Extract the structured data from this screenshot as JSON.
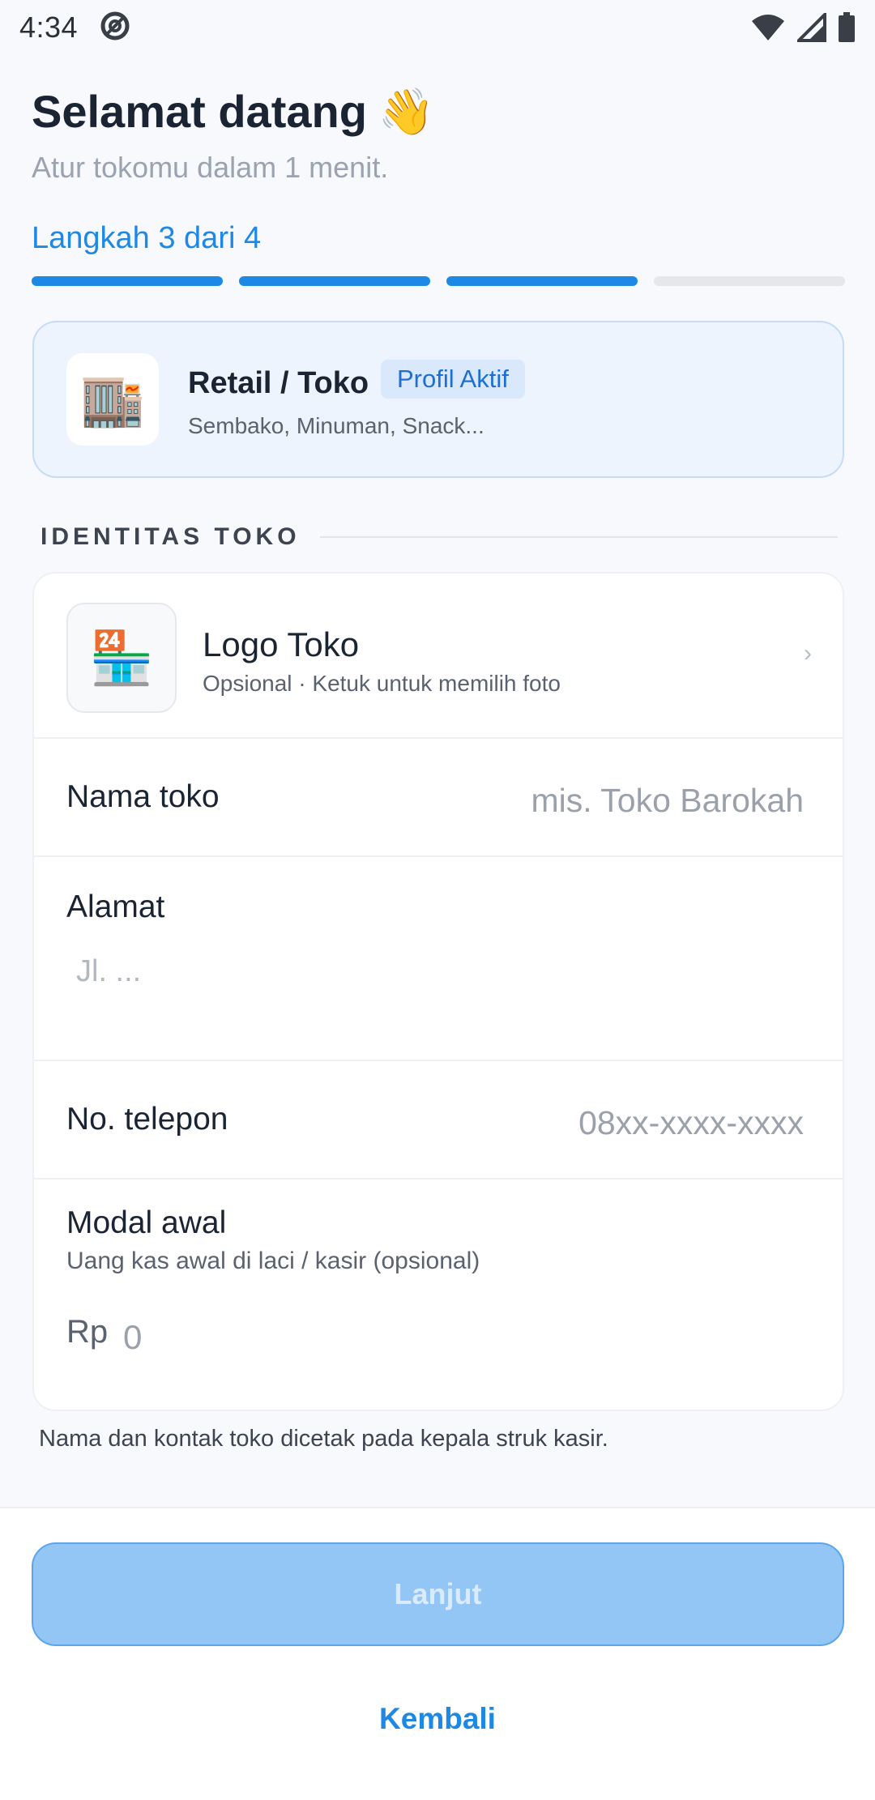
{
  "status_bar": {
    "time": "4:34"
  },
  "header": {
    "title": "Selamat datang",
    "title_emoji": "👋",
    "subtitle": "Atur tokomu dalam 1 menit.",
    "step_label": "Langkah 3 dari 4",
    "progress": {
      "current_step": 3,
      "total_steps": 4
    }
  },
  "profile": {
    "icon": "🏬",
    "name": "Retail / Toko",
    "badge": "Profil Aktif",
    "description": "Sembako, Minuman, Snack..."
  },
  "section": {
    "title": "IDENTITAS TOKO"
  },
  "form": {
    "logo": {
      "icon": "🏪",
      "title": "Logo Toko",
      "subtitle": "Opsional · Ketuk untuk memilih foto",
      "chevron": "›"
    },
    "name": {
      "label": "Nama toko",
      "placeholder": "mis. Toko Barokah",
      "value": ""
    },
    "address": {
      "label": "Alamat",
      "placeholder": "Jl. ...",
      "value": ""
    },
    "phone": {
      "label": "No. telepon",
      "placeholder": "08xx-xxxx-xxxx",
      "value": ""
    },
    "initial_capital": {
      "label": "Modal awal",
      "subtitle": "Uang kas awal di laci / kasir (opsional)",
      "prefix": "Rp",
      "placeholder": "0",
      "value": ""
    }
  },
  "footnote": "Nama dan kontak toko dicetak pada kepala struk kasir.",
  "actions": {
    "next_label": "Lanjut",
    "back_label": "Kembali"
  },
  "colors": {
    "accent": "#1e88e5",
    "progress_inactive": "#e5e7eb",
    "card_highlight_bg": "#eef4fd",
    "button_disabled_bg": "#93c5f5"
  }
}
